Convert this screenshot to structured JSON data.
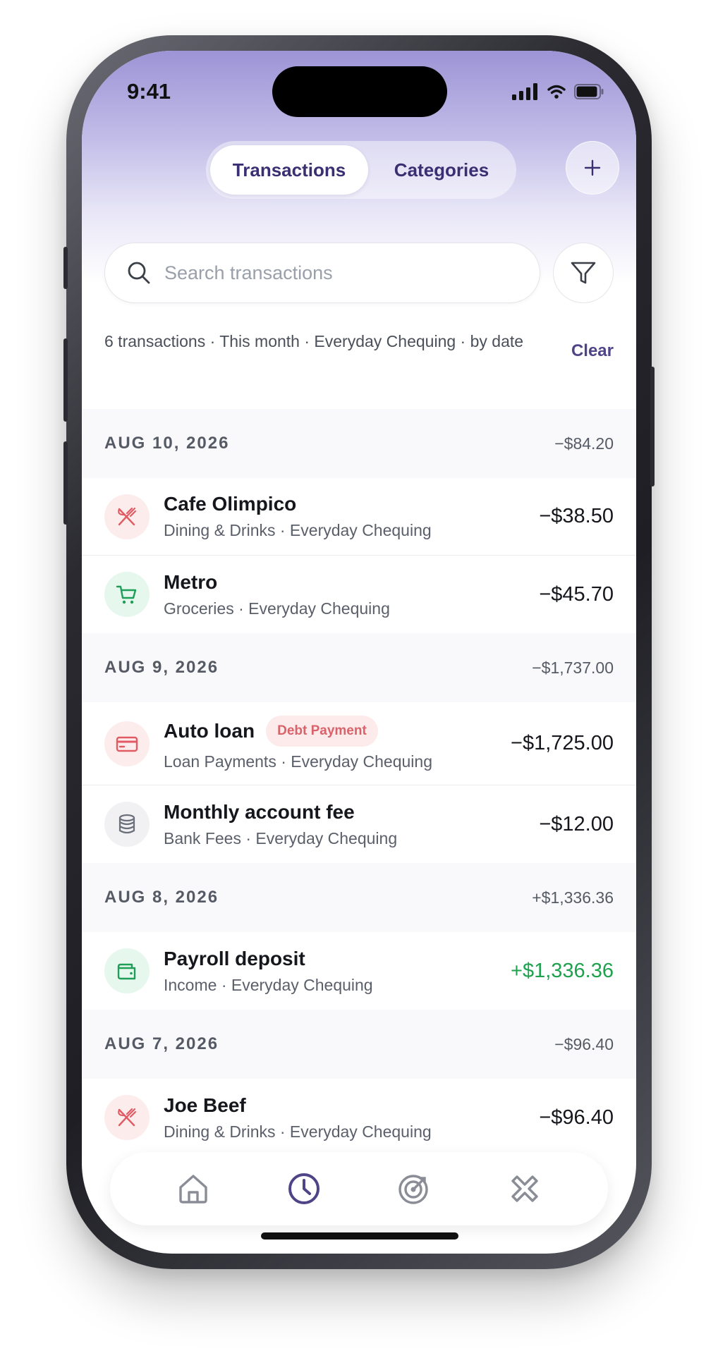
{
  "status_bar": {
    "time": "9:41"
  },
  "header": {
    "tabs": [
      {
        "label": "Transactions",
        "active": true
      },
      {
        "label": "Categories",
        "active": false
      }
    ],
    "add_icon": "plus-icon"
  },
  "search": {
    "placeholder": "Search transactions",
    "value": ""
  },
  "filter": {
    "icon": "filter-icon"
  },
  "summary": {
    "text": "6 transactions · This month · Everyday Chequing · by date",
    "clear_label": "Clear"
  },
  "groups": [
    {
      "date": "AUG 10, 2026",
      "total": "−$84.20",
      "items": [
        {
          "title": "Cafe Olimpico",
          "subtitle": "Dining & Drinks · Everyday Chequing",
          "amount": "−$38.50",
          "icon": "fork-knife-icon"
        },
        {
          "title": "Metro",
          "subtitle": "Groceries · Everyday Chequing",
          "amount": "−$45.70",
          "icon": "cart-icon"
        }
      ]
    },
    {
      "date": "AUG 9, 2026",
      "total": "−$1,737.00",
      "items": [
        {
          "title": "Auto loan",
          "badge": "Debt Payment",
          "subtitle": "Loan Payments · Everyday Chequing",
          "amount": "−$1,725.00",
          "icon": "credit-card-icon"
        },
        {
          "title": "Monthly account fee",
          "subtitle": "Bank Fees · Everyday Chequing",
          "amount": "−$12.00",
          "icon": "database-icon"
        }
      ]
    },
    {
      "date": "AUG 8, 2026",
      "total": "+$1,336.36",
      "items": [
        {
          "title": "Payroll deposit",
          "subtitle": "Income · Everyday Chequing",
          "amount": "+$1,336.36",
          "icon": "wallet-icon"
        }
      ]
    },
    {
      "date": "AUG 7, 2026",
      "total": "−$96.40",
      "items": [
        {
          "title": "Joe Beef",
          "subtitle": "Dining & Drinks · Everyday Chequing",
          "amount": "−$96.40",
          "icon": "fork-knife-icon"
        }
      ]
    }
  ],
  "tabbar": {
    "items": [
      {
        "icon": "home-icon",
        "active": false
      },
      {
        "icon": "clock-icon",
        "active": true
      },
      {
        "icon": "target-icon",
        "active": false
      },
      {
        "icon": "tools-icon",
        "active": false
      }
    ]
  },
  "colors": {
    "accent": "#4f4488",
    "positive": "#1ea24e",
    "debt_badge_bg": "#fdeaea",
    "debt_badge_text": "#d9636b"
  }
}
